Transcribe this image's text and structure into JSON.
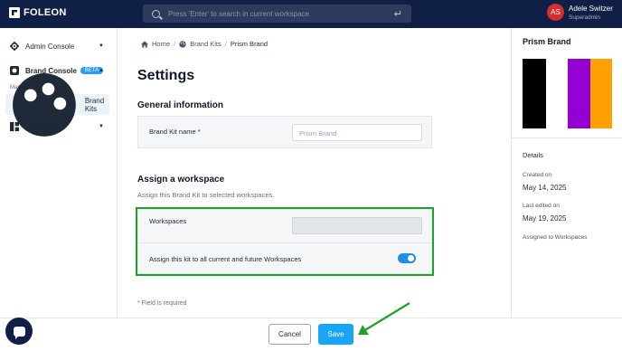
{
  "topbar": {
    "logo_text": "FOLEON",
    "search_placeholder": "Press 'Enter' to search in current workspace",
    "user_initials": "AS",
    "user_name": "Adele Switzer",
    "user_role": "Superadmin"
  },
  "sidebar": {
    "admin_console": "Admin Console",
    "brand_console": "Brand Console",
    "beta_badge": "BETA",
    "sub_label": "Manage account-level",
    "brand_kits": "Brand Kits",
    "workspaces": "Workspaces"
  },
  "breadcrumb": {
    "home": "Home",
    "brand_kits": "Brand Kits",
    "current": "Prism Brand"
  },
  "main": {
    "title": "Settings",
    "general_title": "General information",
    "brand_kit_name_label": "Brand Kit name *",
    "brand_kit_name_placeholder": "Prism Brand",
    "assign_title": "Assign a workspace",
    "assign_hint": "Assign this Brand Kit to selected workspaces.",
    "workspaces_label": "Workspaces",
    "toggle_label": "Assign this kit to all current and future Workspaces",
    "toggle_on": true,
    "required_note": "* Field is required"
  },
  "right_panel": {
    "title": "Prism Brand",
    "swatches": [
      "#000000",
      "#ffffff",
      "#9400d3",
      "#ff9f00"
    ],
    "details_heading": "Details",
    "created_label": "Created on",
    "created_value": "May 14, 2025",
    "edited_label": "Last edited on",
    "edited_value": "May 19, 2025",
    "assigned_label": "Assigned to Workspaces"
  },
  "footer": {
    "cancel": "Cancel",
    "save": "Save"
  },
  "colors": {
    "topbar": "#0f1f45",
    "highlight": "#22a12a",
    "primary": "#19a5f5"
  }
}
